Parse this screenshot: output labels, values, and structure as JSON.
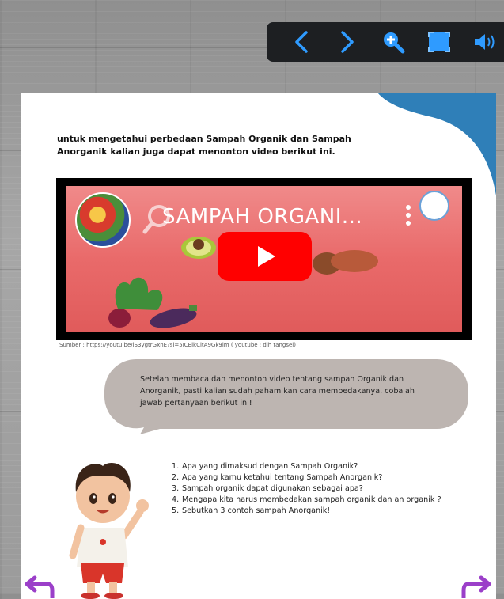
{
  "toolbar": {
    "buttons": [
      {
        "name": "previous-page-button",
        "icon": "chevron-left-icon"
      },
      {
        "name": "next-page-button",
        "icon": "chevron-right-icon"
      },
      {
        "name": "zoom-in-button",
        "icon": "zoom-in-icon"
      },
      {
        "name": "fullscreen-button",
        "icon": "fullscreen-icon"
      },
      {
        "name": "sound-button",
        "icon": "speaker-icon"
      }
    ],
    "accent": "#2f9bff"
  },
  "page": {
    "intro": "untuk mengetahui perbedaan Sampah Organik dan Sampah Anorganik kalian juga dapat menonton video berikut ini.",
    "video": {
      "title": "SAMPAH ORGANI...",
      "play_icon": "youtube-play-icon"
    },
    "source": "Sumber : https://youtu.be/iS3ygtrGxnE?si=5ICEikCitA9Gk9im ( youtube ; dih tangsel)",
    "bubble_text": "Setelah membaca dan menonton video tentang sampah Organik dan Anorganik, pasti kalian sudah paham kan cara membedakanya. cobalah jawab pertanyaan berikut ini!",
    "questions": [
      {
        "num": "1.",
        "text": "Apa yang dimaksud dengan Sampah Organik?"
      },
      {
        "num": "2.",
        "text": "Apa yang kamu ketahui tentang Sampah Anorganik?"
      },
      {
        "num": "3.",
        "text": "Sampah organik dapat digunakan sebagai apa?"
      },
      {
        "num": "4.",
        "text": "Mengapa kita harus membedakan sampah organik dan an organik ?"
      },
      {
        "num": "5.",
        "text": "Sebutkan 3 contoh sampah Anorganik!"
      }
    ]
  },
  "colors": {
    "corner_blue": "#2f7fb8",
    "bubble": "#bdb5b1",
    "nav_arrow": "#9b3fc9"
  }
}
